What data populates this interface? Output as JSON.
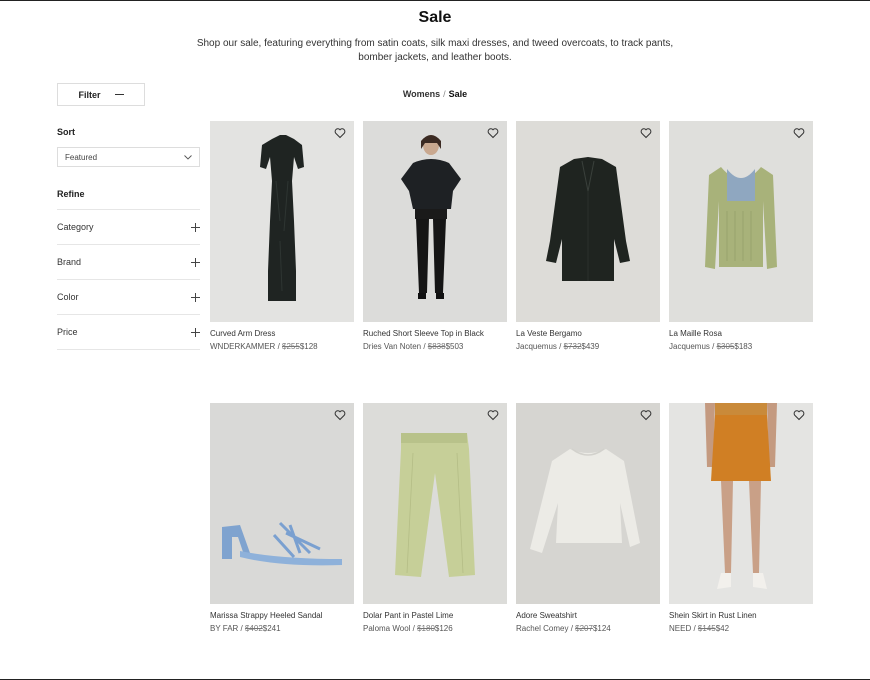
{
  "header": {
    "title": "Sale",
    "description": "Shop our sale, featuring everything from satin coats, silk maxi dresses, and tweed overcoats, to track pants, bomber jackets, and leather boots."
  },
  "filter": {
    "label": "Filter"
  },
  "breadcrumb": {
    "parent": "Womens",
    "separator": "/",
    "current": "Sale"
  },
  "sort": {
    "label": "Sort",
    "selected": "Featured"
  },
  "refine": {
    "label": "Refine",
    "items": [
      {
        "label": "Category"
      },
      {
        "label": "Brand"
      },
      {
        "label": "Color"
      },
      {
        "label": "Price"
      }
    ]
  },
  "products": [
    {
      "name": "Curved Arm Dress",
      "brand": "WNDERKAMMER",
      "original_price": "$255",
      "sale_price": "$128",
      "icon": "dress-image",
      "bg": "#e3e3e1"
    },
    {
      "name": "Ruched Short Sleeve Top in Black",
      "brand": "Dries Van Noten",
      "original_price": "$838",
      "sale_price": "$503",
      "icon": "model-image",
      "bg": "#dcdcda"
    },
    {
      "name": "La Veste Bergamo",
      "brand": "Jacquemus",
      "original_price": "$732",
      "sale_price": "$439",
      "icon": "blazer-image",
      "bg": "#dddcd8"
    },
    {
      "name": "La Maille Rosa",
      "brand": "Jacquemus",
      "original_price": "$305",
      "sale_price": "$183",
      "icon": "knit-top-image",
      "bg": "#dfdfdc"
    },
    {
      "name": "Marissa Strappy Heeled Sandal",
      "brand": "BY FAR",
      "original_price": "$402",
      "sale_price": "$241",
      "icon": "sandal-image",
      "bg": "#d9d9d7"
    },
    {
      "name": "Dolar Pant in Pastel Lime",
      "brand": "Paloma Wool",
      "original_price": "$180",
      "sale_price": "$126",
      "icon": "pants-image",
      "bg": "#dcdcd9"
    },
    {
      "name": "Adore Sweatshirt",
      "brand": "Rachel Comey",
      "original_price": "$207",
      "sale_price": "$124",
      "icon": "sweatshirt-image",
      "bg": "#d6d5d1"
    },
    {
      "name": "Shein Skirt in Rust Linen",
      "brand": "NEED",
      "original_price": "$145",
      "sale_price": "$42",
      "icon": "skirt-image",
      "bg": "#e4e4e2"
    }
  ],
  "colors": {
    "text": "#222222",
    "border": "#dddddd",
    "heart": "#333333"
  }
}
